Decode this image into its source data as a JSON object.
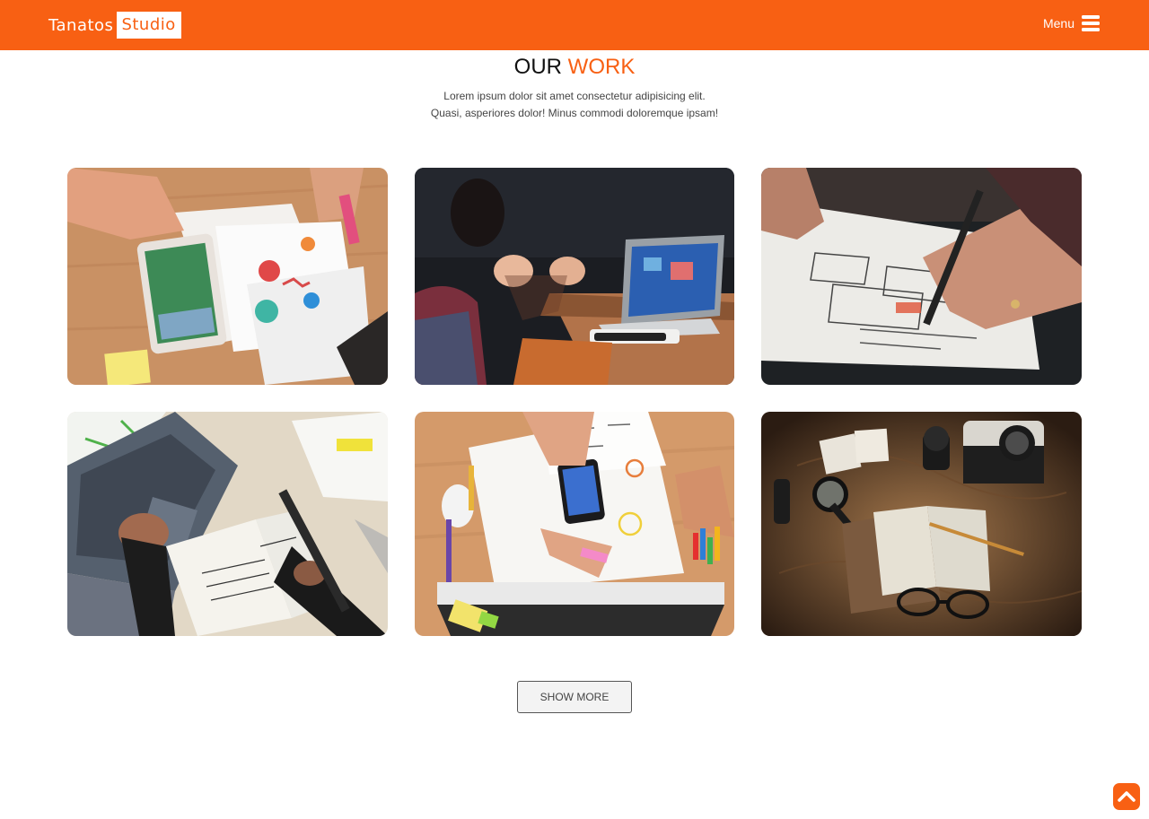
{
  "brand": {
    "name_part1": "Tanatos",
    "name_part2": "Studio",
    "color": "#f86013"
  },
  "nav": {
    "menu_label": "Menu",
    "menu_icon": "hamburger-icon"
  },
  "section": {
    "title_part1": "OUR",
    "title_part2": "WORK",
    "description_line1": "Lorem ipsum dolor sit amet consectetur adipisicing elit.",
    "description_line2": "Quasi, asperiores dolor! Minus commodi doloremque ipsam!"
  },
  "gallery": {
    "items": [
      {
        "subject": "tablet-and-charts-photo"
      },
      {
        "subject": "team-meeting-laptop-photo"
      },
      {
        "subject": "wireframe-sketching-photo"
      },
      {
        "subject": "laptop-and-notebook-photo"
      },
      {
        "subject": "ux-planning-desk-photo"
      },
      {
        "subject": "vintage-camera-map-photo"
      }
    ]
  },
  "actions": {
    "show_more_label": "SHOW MORE",
    "back_to_top_icon": "chevron-up-icon"
  }
}
